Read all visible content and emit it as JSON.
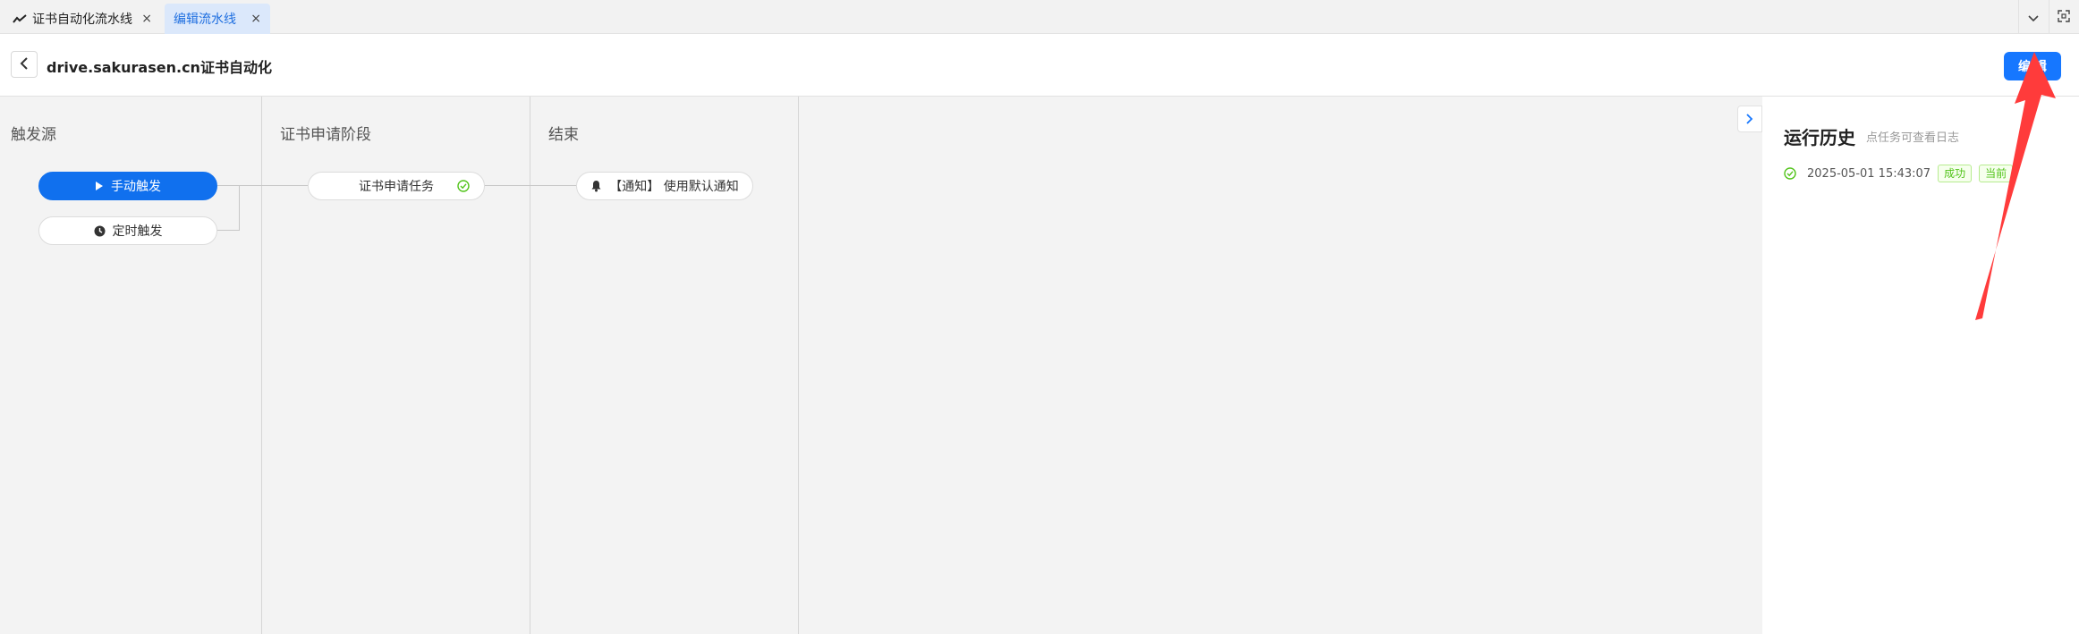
{
  "tabs": [
    {
      "label": "证书自动化流水线",
      "close": "×",
      "active": false
    },
    {
      "label": "编辑流水线",
      "close": "×",
      "active": true
    }
  ],
  "header": {
    "title": "drive.sakurasen.cn证书自动化",
    "edit_label": "编 辑"
  },
  "stages": [
    {
      "title": "触发源"
    },
    {
      "title": "证书申请阶段"
    },
    {
      "title": "结束"
    }
  ],
  "nodes": {
    "manual_trigger": "手动触发",
    "timer_trigger": "定时触发",
    "cert_task": "证书申请任务",
    "notify": "【通知】 使用默认通知"
  },
  "history": {
    "title": "运行历史",
    "hint": "点任务可查看日志",
    "items": [
      {
        "time": "2025-05-01 15:43:07",
        "status": "成功",
        "current": "当前"
      }
    ]
  },
  "colors": {
    "accent": "#1677ff",
    "success": "#52c41a",
    "annotation_arrow": "#ff3b3b"
  }
}
